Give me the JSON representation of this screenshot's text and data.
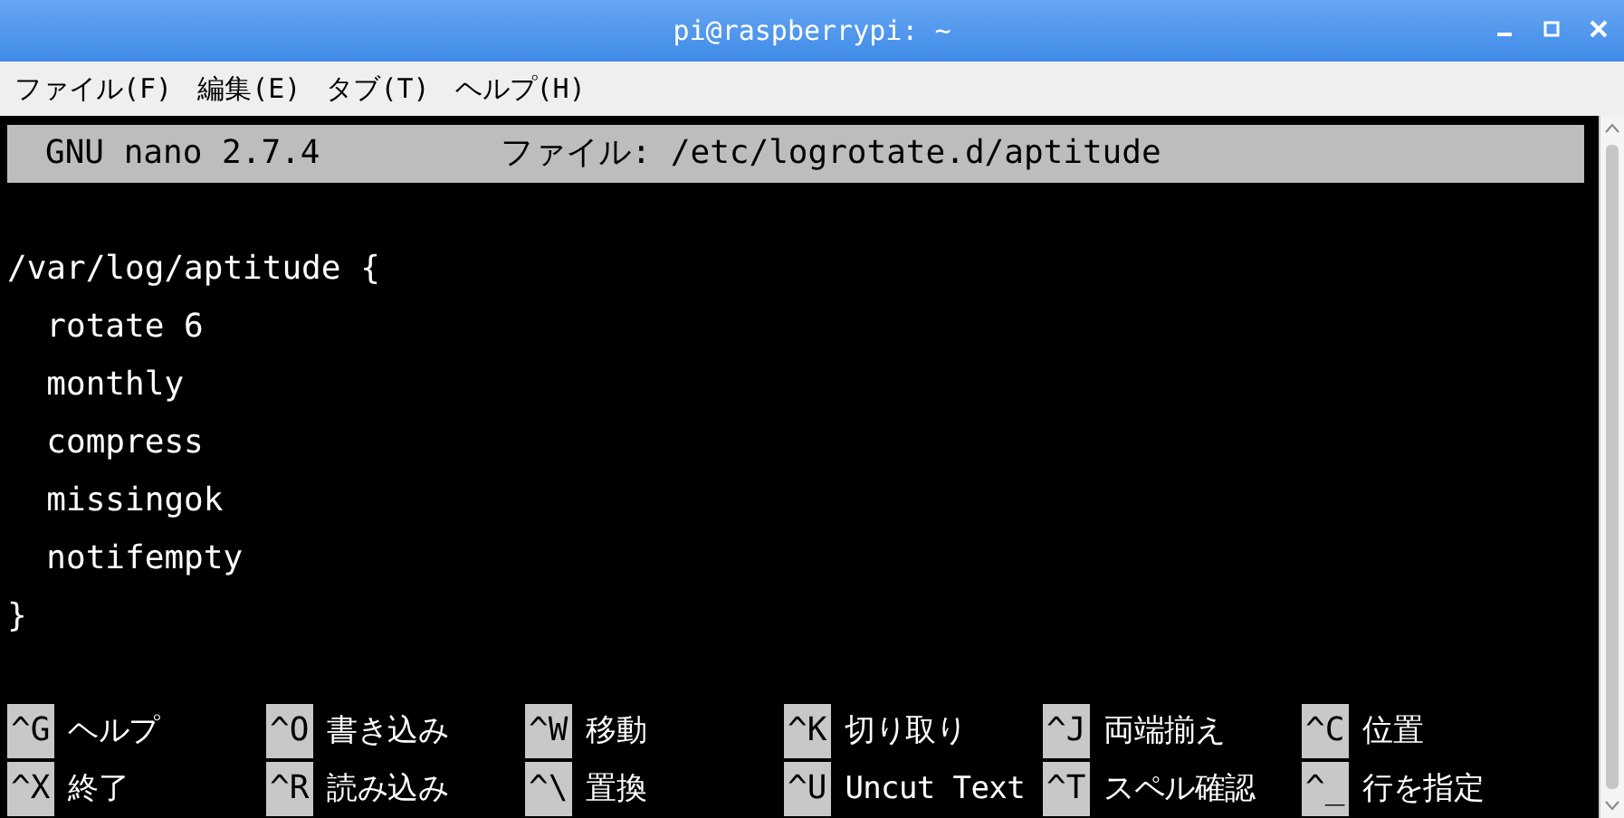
{
  "window": {
    "title": "pi@raspberrypi: ~"
  },
  "menu": [
    "ファイル(F)",
    "編集(E)",
    "タブ(T)",
    "ヘルプ(H)"
  ],
  "nano": {
    "version": "GNU nano 2.7.4",
    "file": "ファイル: /etc/logrotate.d/aptitude"
  },
  "lines": [
    "/var/log/aptitude {",
    "  rotate 6",
    "  monthly",
    "  compress",
    "  missingok",
    "  notifempty",
    "}"
  ],
  "shortcuts": [
    [
      {
        "key": "^G",
        "label": "ヘルプ"
      },
      {
        "key": "^O",
        "label": "書き込み"
      },
      {
        "key": "^W",
        "label": "移動"
      },
      {
        "key": "^K",
        "label": "切り取り"
      },
      {
        "key": "^J",
        "label": "両端揃え"
      },
      {
        "key": "^C",
        "label": "位置"
      }
    ],
    [
      {
        "key": "^X",
        "label": "終了"
      },
      {
        "key": "^R",
        "label": "読み込み"
      },
      {
        "key": "^\\",
        "label": "置換"
      },
      {
        "key": "^U",
        "label": "Uncut Text"
      },
      {
        "key": "^T",
        "label": "スペル確認"
      },
      {
        "key": "^_",
        "label": "行を指定"
      }
    ]
  ]
}
